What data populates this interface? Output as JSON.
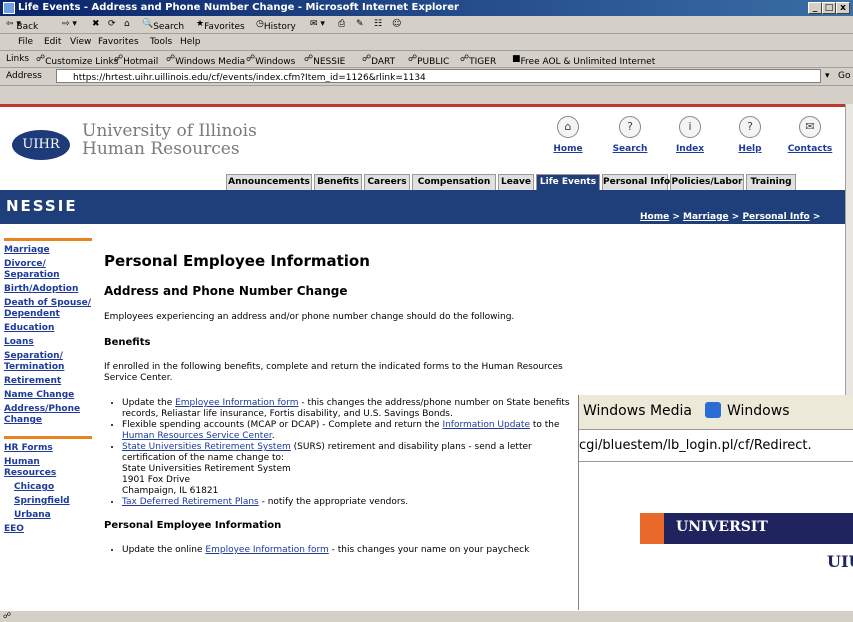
{
  "window": {
    "title": "Life Events - Address and Phone Number Change - Microsoft Internet Explorer",
    "min": "_",
    "max": "□",
    "close": "x"
  },
  "toolbar": {
    "back": "Back",
    "search": "Search",
    "favorites": "Favorites",
    "history": "History"
  },
  "menu": [
    "File",
    "Edit",
    "View",
    "Favorites",
    "Tools",
    "Help"
  ],
  "links_bar": {
    "label": "Links",
    "items": [
      "Customize Links",
      "Hotmail",
      "Windows Media",
      "Windows",
      "NESSIE",
      "DART",
      "PUBLIC",
      "TIGER",
      "Free AOL & Unlimited Internet"
    ]
  },
  "address": {
    "label": "Address",
    "url": "https://hrtest.uihr.uillinois.edu/cf/events/index.cfm?Item_id=1126&rlink=1134",
    "go": "Go"
  },
  "site": {
    "logo": "UIHR",
    "name_line1": "University of Illinois",
    "name_line2": "Human Resources",
    "top_icons": [
      {
        "label": "Home",
        "glyph": "⌂"
      },
      {
        "label": "Search",
        "glyph": "?"
      },
      {
        "label": "Index",
        "glyph": "i"
      },
      {
        "label": "Help",
        "glyph": "?"
      },
      {
        "label": "Contacts",
        "glyph": "✉"
      }
    ],
    "tabs": [
      "Announcements",
      "Benefits",
      "Careers",
      "Compensation",
      "Leave",
      "Life Events",
      "Personal Info",
      "Policies/Labor",
      "Training"
    ],
    "active_tab": "Life Events",
    "section_title": "NESSIE",
    "breadcrumb": [
      "Home",
      "Marriage",
      "Personal Info"
    ]
  },
  "sidebar": {
    "group1": [
      "Marriage",
      "Divorce/ Separation",
      "Birth/Adoption",
      "Death of Spouse/ Dependent",
      "Education",
      "Loans",
      "Separation/ Termination",
      "Retirement",
      "Name Change",
      "Address/Phone Change"
    ],
    "group2": [
      "HR Forms",
      "Human Resources"
    ],
    "group2_sub": [
      "Chicago",
      "Springfield",
      "Urbana"
    ],
    "group2_end": [
      "EEO"
    ]
  },
  "main": {
    "heading": "Personal Employee Information",
    "subheading": "Address and Phone Number Change",
    "intro": "Employees experiencing an address and/or phone number change should do the following.",
    "benefits_heading": "Benefits",
    "benefits_intro": "If enrolled in the following benefits, complete and return the indicated forms to the Human Resources Service Center.",
    "b1_pre": "Update the ",
    "b1_link": "Employee Information form",
    "b1_post": " - this changes the address/phone number on State benefits records, Reliastar life insurance, Fortis disability, and U.S. Savings Bonds.",
    "b2_pre": "Flexible spending accounts (MCAP or DCAP) - Complete and return the ",
    "b2_link": "Information Update",
    "b2_mid": " to the ",
    "b2_link2": "Human Resources Service Center",
    "b2_post": ".",
    "b3_link": "State Universities Retirement System",
    "b3_post": " (SURS) retirement and disability plans - send a letter certification of the name change to:",
    "b3_addr1": "State Universities Retirement System",
    "b3_addr2": "1901 Fox Drive",
    "b3_addr3": "Champaign, IL 61821",
    "b4_link": "Tax Deferred Retirement Plans",
    "b4_post": " - notify the appropriate vendors.",
    "personal_heading": "Personal Employee Information",
    "p1_pre": "Update the online ",
    "p1_link": "Employee Information form",
    "p1_post": " - this changes your name on your paycheck"
  },
  "overlay": {
    "links": [
      "Windows Media",
      "Windows"
    ],
    "url_fragment": "cgi/bluestem/lb_login.pl/cf/Redirect.",
    "banner": "UNIVERSIT",
    "sub": "UIU"
  },
  "colors": {
    "accent_navy": "#1f3f7a",
    "accent_red": "#c0392b",
    "accent_orange": "#e8831f"
  }
}
